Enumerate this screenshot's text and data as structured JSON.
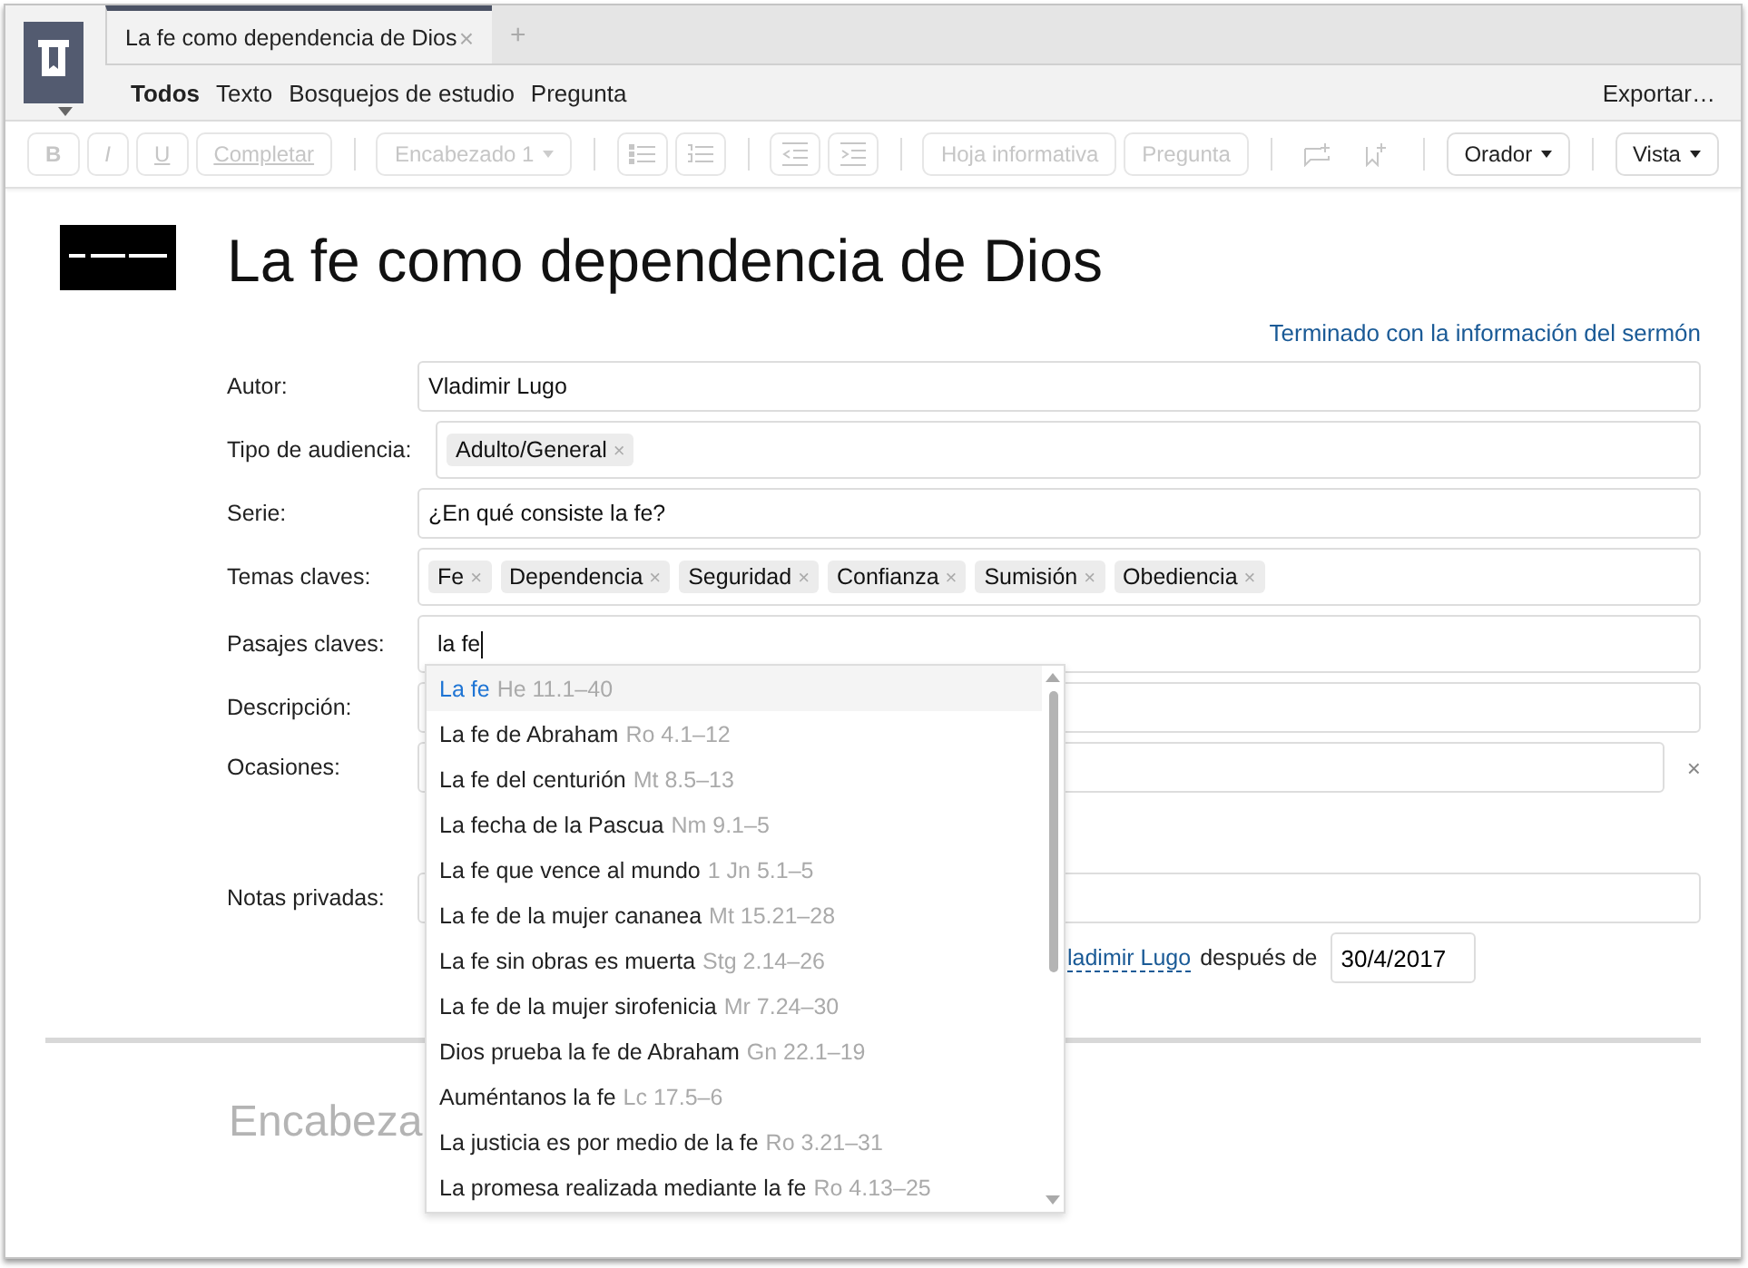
{
  "tabs": [
    {
      "title": "La fe como dependencia de Dios",
      "close": "×",
      "selected": true
    }
  ],
  "new_tab": "+",
  "nav": [
    {
      "label": "Todos",
      "selected": true
    },
    {
      "label": "Texto",
      "selected": false
    },
    {
      "label": "Bosquejos de estudio",
      "selected": false
    },
    {
      "label": "Pregunta",
      "selected": false
    }
  ],
  "export": "Exportar…",
  "toolbar": [
    {
      "kind": "bold",
      "label": "B",
      "disabled": true
    },
    {
      "kind": "italic",
      "label": "I",
      "disabled": true
    },
    {
      "kind": "underline",
      "label": "U",
      "disabled": true
    },
    {
      "kind": "button",
      "label": "Completar",
      "disabled": true,
      "underlined": true
    },
    {
      "kind": "sep"
    },
    {
      "kind": "dropdown",
      "label": "Encabezado 1",
      "disabled": true
    },
    {
      "kind": "sep"
    },
    {
      "kind": "bullets",
      "disabled": true
    },
    {
      "kind": "numbers",
      "disabled": true
    },
    {
      "kind": "sep"
    },
    {
      "kind": "outdent",
      "disabled": true
    },
    {
      "kind": "indent",
      "disabled": true
    },
    {
      "kind": "sep"
    },
    {
      "kind": "button",
      "label": "Hoja informativa",
      "disabled": true
    },
    {
      "kind": "button",
      "label": "Pregunta",
      "disabled": true
    },
    {
      "kind": "sep"
    },
    {
      "kind": "comment",
      "disabled": true
    },
    {
      "kind": "bookmark",
      "disabled": true
    },
    {
      "kind": "sep"
    },
    {
      "kind": "menu",
      "label": "Orador",
      "disabled": false
    },
    {
      "kind": "sep"
    },
    {
      "kind": "menu",
      "label": "Vista",
      "disabled": false
    }
  ],
  "document": {
    "title": "La fe como dependencia de Dios",
    "done_link": "Terminado con la información del sermón"
  },
  "fields": [
    {
      "kind": "text",
      "label": "Autor:",
      "value": "Vladimir Lugo"
    },
    {
      "kind": "tags",
      "label": "Tipo de audiencia:",
      "tags": [
        {
          "label": "Adulto/General",
          "remove": "×"
        }
      ]
    },
    {
      "kind": "text",
      "label": "Serie:",
      "value": "¿En qué consiste la fe?"
    },
    {
      "kind": "tags",
      "label": "Temas claves:",
      "tags": [
        {
          "label": "Fe",
          "remove": "×"
        },
        {
          "label": "Dependencia",
          "remove": "×"
        },
        {
          "label": "Seguridad",
          "remove": "×"
        },
        {
          "label": "Confianza",
          "remove": "×"
        },
        {
          "label": "Sumisión",
          "remove": "×"
        },
        {
          "label": "Obediencia",
          "remove": "×"
        }
      ]
    },
    {
      "kind": "search",
      "label": "Pasajes claves:",
      "value": "la fe"
    },
    {
      "kind": "text",
      "label": "Descripción:"
    },
    {
      "kind": "removable",
      "label": "Ocasiones:",
      "remove": "×"
    },
    {
      "kind": "text",
      "label": "Notas privadas:"
    }
  ],
  "share_row": {
    "author_link": "ladimir Lugo",
    "after": "después de",
    "date": "30/4/2017"
  },
  "suggestions": [
    {
      "title": "La fe",
      "ref": "He 11.1–40",
      "selected": true
    },
    {
      "title": "La fe de Abraham",
      "ref": "Ro 4.1–12",
      "selected": false
    },
    {
      "title": "La fe del centurión",
      "ref": "Mt 8.5–13",
      "selected": false
    },
    {
      "title": "La fecha de la Pascua",
      "ref": "Nm 9.1–5",
      "selected": false
    },
    {
      "title": "La fe que vence al mundo",
      "ref": "1 Jn 5.1–5",
      "selected": false
    },
    {
      "title": "La fe de la mujer cananea",
      "ref": "Mt 15.21–28",
      "selected": false
    },
    {
      "title": "La fe sin obras es muerta",
      "ref": "Stg 2.14–26",
      "selected": false
    },
    {
      "title": "La fe de la mujer sirofenicia",
      "ref": "Mr 7.24–30",
      "selected": false
    },
    {
      "title": "Dios prueba la fe de Abraham",
      "ref": "Gn 22.1–19",
      "selected": false
    },
    {
      "title": "Auméntanos la fe",
      "ref": "Lc 17.5–6",
      "selected": false
    },
    {
      "title": "La justicia es por medio de la fe",
      "ref": "Ro 3.21–31",
      "selected": false
    },
    {
      "title": "La promesa realizada mediante la fe",
      "ref": "Ro 4.13–25",
      "selected": false
    }
  ],
  "heading_placeholder": "Encabeza"
}
